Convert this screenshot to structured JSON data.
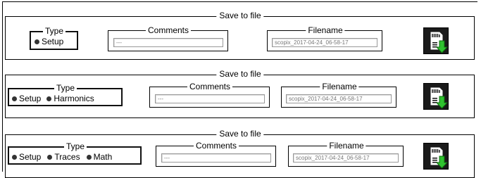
{
  "panels": [
    {
      "title": "Save to file",
      "type_title": "Type",
      "type_options": [
        "Setup"
      ],
      "comments_title": "Comments",
      "comments_value": "---",
      "filename_title": "Filename",
      "filename_value": "scopix_2017-04-24_06-58-17"
    },
    {
      "title": "Save to file",
      "type_title": "Type",
      "type_options": [
        "Setup",
        "Harmonics"
      ],
      "comments_title": "Comments",
      "comments_value": "---",
      "filename_title": "Filename",
      "filename_value": "scopix_2017-04-24_06-58-17"
    },
    {
      "title": "Save to file",
      "type_title": "Type",
      "type_options": [
        "Setup",
        "Traces",
        "Math"
      ],
      "comments_title": "Comments",
      "comments_value": "---",
      "filename_title": "Filename",
      "filename_value": "scopix_2017-04-24_06-58-17"
    }
  ],
  "icons": {
    "save": "sd-card-save-icon",
    "accent_color": "#2fc22f"
  }
}
